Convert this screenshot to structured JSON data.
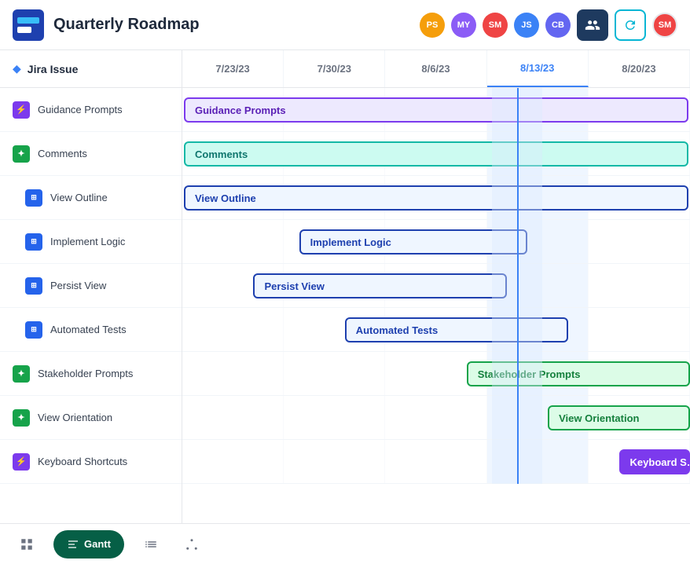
{
  "header": {
    "title": "Quarterly Roadmap",
    "avatars": [
      {
        "initials": "PS",
        "color": "#f59e0b"
      },
      {
        "initials": "MY",
        "color": "#8b5cf6"
      },
      {
        "initials": "SM",
        "color": "#ef4444"
      },
      {
        "initials": "JS",
        "color": "#3b82f6"
      },
      {
        "initials": "CB",
        "color": "#6366f1"
      }
    ],
    "user_avatar": {
      "initials": "SM",
      "color": "#ef4444"
    }
  },
  "sidebar": {
    "header": "Jira Issue",
    "rows": [
      {
        "label": "Guidance Prompts",
        "icon": "⚡",
        "icon_class": "purple",
        "indent": false
      },
      {
        "label": "Comments",
        "icon": "✦",
        "icon_class": "green",
        "indent": false
      },
      {
        "label": "View Outline",
        "icon": "⊞",
        "icon_class": "blue",
        "indent": true
      },
      {
        "label": "Implement Logic",
        "icon": "⊞",
        "icon_class": "blue",
        "indent": true
      },
      {
        "label": "Persist View",
        "icon": "⊞",
        "icon_class": "blue",
        "indent": true
      },
      {
        "label": "Automated Tests",
        "icon": "⊞",
        "icon_class": "blue",
        "indent": true
      },
      {
        "label": "Stakeholder Prompts",
        "icon": "✦",
        "icon_class": "green",
        "indent": false
      },
      {
        "label": "View Orientation",
        "icon": "✦",
        "icon_class": "green",
        "indent": false
      },
      {
        "label": "Keyboard Shortcuts",
        "icon": "⚡",
        "icon_class": "purple",
        "indent": false
      }
    ]
  },
  "gantt": {
    "columns": [
      {
        "label": "7/23/23",
        "active": false
      },
      {
        "label": "7/30/23",
        "active": false
      },
      {
        "label": "8/6/23",
        "active": false
      },
      {
        "label": "8/13/23",
        "active": true
      },
      {
        "label": "8/20/23",
        "active": false
      }
    ],
    "bars": [
      {
        "label": "Guidance Prompts",
        "row": 0,
        "left": "0%",
        "width": "100%",
        "style": "purple"
      },
      {
        "label": "Comments",
        "row": 1,
        "left": "0%",
        "width": "100%",
        "style": "teal"
      },
      {
        "label": "View Outline",
        "row": 2,
        "left": "0%",
        "width": "100%",
        "style": "navy-outline"
      },
      {
        "label": "Implement Logic",
        "row": 3,
        "left": "22%",
        "width": "45%",
        "style": "navy-outline"
      },
      {
        "label": "Persist View",
        "row": 4,
        "left": "14%",
        "width": "50%",
        "style": "navy-outline"
      },
      {
        "label": "Automated Tests",
        "row": 5,
        "left": "30%",
        "width": "44%",
        "style": "navy-outline"
      },
      {
        "label": "Stakeholder Prompts",
        "row": 6,
        "left": "56%",
        "width": "44%",
        "style": "green"
      },
      {
        "label": "View Orientation",
        "row": 7,
        "left": "72%",
        "width": "28%",
        "style": "green"
      },
      {
        "label": "Keyboard Shortcuts",
        "row": 8,
        "left": "86%",
        "width": "14%",
        "style": "purple-solid"
      }
    ]
  },
  "toolbar": {
    "gantt_label": "Gantt",
    "active_view": "gantt"
  }
}
